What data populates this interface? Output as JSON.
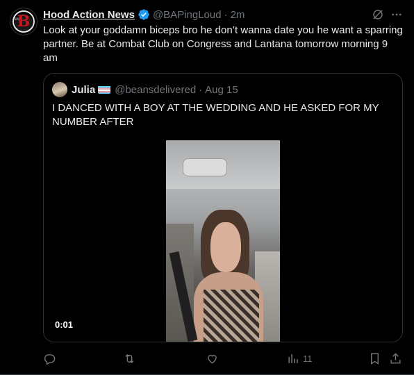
{
  "tweet": {
    "display_name": "Hood Action News",
    "handle": "@BAPingLoud",
    "time": "2m",
    "text": "Look at your goddamn biceps bro he don’t wanna date you he want a sparring partner. Be at Combat Club on Congress and Lantana tomorrow morning 9 am"
  },
  "quote": {
    "display_name": "Julia",
    "handle": "@beansdelivered",
    "time": "Aug 15",
    "text": "I DANCED WITH A BOY AT THE WEDDING AND HE ASKED FOR MY NUMBER AFTER",
    "video_duration": "0:01"
  },
  "actions": {
    "views_count": "11"
  },
  "colors": {
    "background": "#000000",
    "text": "#e7e9ea",
    "muted": "#71767b",
    "verified": "#1d9bf0",
    "border": "#2f3336"
  },
  "icons": [
    "verified-badge-icon",
    "grok-icon",
    "more-icon",
    "reply-icon",
    "retweet-icon",
    "like-icon",
    "views-icon",
    "bookmark-icon",
    "share-icon"
  ]
}
